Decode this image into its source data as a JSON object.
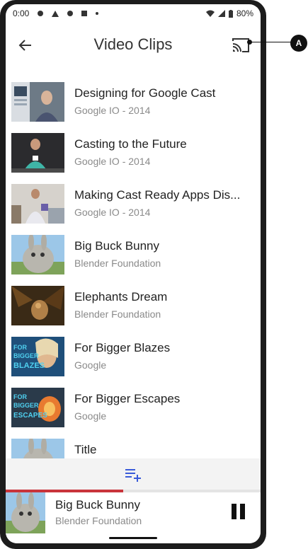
{
  "status_bar": {
    "time": "0:00",
    "battery": "80%"
  },
  "app_bar": {
    "title": "Video Clips"
  },
  "clips": [
    {
      "title": "Designing for Google Cast",
      "subtitle": "Google IO - 2014",
      "thumb": "google-io-speaker-1"
    },
    {
      "title": "Casting to the Future",
      "subtitle": "Google IO - 2014",
      "thumb": "google-io-speaker-2"
    },
    {
      "title": "Making Cast Ready Apps Dis...",
      "subtitle": "Google IO - 2014",
      "thumb": "google-io-speaker-3"
    },
    {
      "title": "Big Buck Bunny",
      "subtitle": "Blender Foundation",
      "thumb": "bunny"
    },
    {
      "title": "Elephants Dream",
      "subtitle": "Blender Foundation",
      "thumb": "elephants-dream"
    },
    {
      "title": "For Bigger Blazes",
      "subtitle": "Google",
      "thumb": "for-bigger-blazes"
    },
    {
      "title": "For Bigger Escapes",
      "subtitle": "Google",
      "thumb": "for-bigger-escapes"
    },
    {
      "title": "Title",
      "subtitle": "",
      "thumb": "bunny"
    }
  ],
  "mini_controller": {
    "title": "Big Buck Bunny",
    "subtitle": "Blender Foundation",
    "progress": 0.46
  },
  "callout": {
    "label": "A"
  },
  "colors": {
    "progress": "#c9343b",
    "queue_icon": "#3a5bd9"
  }
}
